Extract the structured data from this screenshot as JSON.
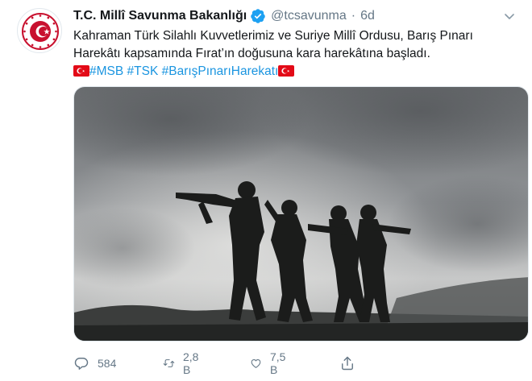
{
  "tweet": {
    "author_name": "T.C. Millî Savunma Bakanlığı",
    "handle": "@tcsavunma",
    "separator": "·",
    "time": "6d",
    "verified": true,
    "text_line1": "Kahraman Türk Silahlı Kuvvetlerimiz ve Suriye Millî Ordusu, Barış Pınarı",
    "text_line2": "Harekâtı kapsamında Fırat’ın doğusuna kara harekâtına başladı.",
    "hashtags": [
      "#MSB",
      "#TSK",
      "#BarışPınarıHarekatı"
    ],
    "flag_emoji": "turkey-flag"
  },
  "actions": {
    "reply_count": "584",
    "retweet_count": "2,8 B",
    "like_count": "7,5 B"
  },
  "icons": [
    "ministry-emblem-icon",
    "verified-badge-icon",
    "chevron-down-icon",
    "turkey-flag-icon",
    "reply-icon",
    "retweet-icon",
    "like-icon",
    "share-icon"
  ],
  "colors": {
    "accent": "#1b95e0",
    "muted": "#657786",
    "text": "#14171a",
    "flag_red": "#e30a17",
    "emblem_red": "#c8102e"
  }
}
